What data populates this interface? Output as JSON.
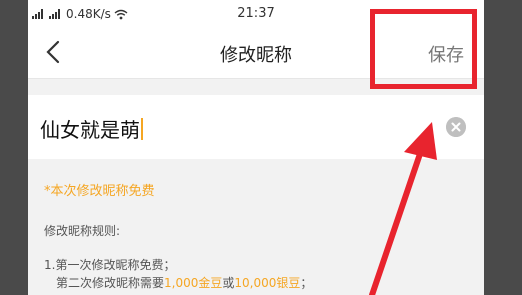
{
  "status_bar": {
    "network": "0.48K/s",
    "time": "21:37"
  },
  "navbar": {
    "title": "修改昵称",
    "save_label": "保存"
  },
  "nickname_input": {
    "value": "仙女就是萌"
  },
  "notice": "*本次修改昵称免费",
  "rules": {
    "title": "修改昵称规则:",
    "line1": "1.第一次修改昵称免费；",
    "line2_prefix": "第二次修改昵称需要",
    "line2_gold": "1,000金豆",
    "line2_or": "或",
    "line2_silver": "10,000银豆",
    "line2_suffix": "；"
  },
  "colors": {
    "accent": "#f5a623",
    "highlight": "#e8242e"
  },
  "icons": [
    "back-arrow-icon",
    "clear-input-icon",
    "wifi-icon",
    "signal-icon"
  ]
}
